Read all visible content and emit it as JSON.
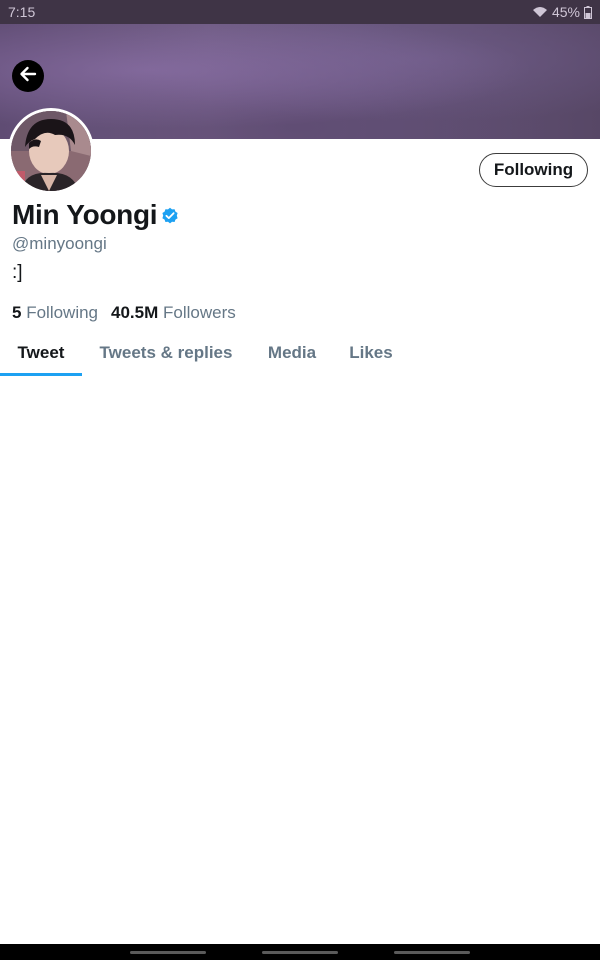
{
  "status_bar": {
    "time": "7:15",
    "battery": "45%",
    "icons": [
      "wifi-icon",
      "battery-icon"
    ]
  },
  "header": {
    "back_icon": "arrow-left-icon"
  },
  "profile": {
    "display_name": "Min Yoongi",
    "verified_icon": "verified-badge-icon",
    "handle": "@minyoongi",
    "bio": ":]",
    "follow_button_label": "Following",
    "following_count": "5",
    "following_label": "Following",
    "followers_count": "40.5M",
    "followers_label": "Followers"
  },
  "tabs": [
    {
      "label": "Tweet",
      "active": true
    },
    {
      "label": "Tweets & replies",
      "active": false
    },
    {
      "label": "Media",
      "active": false
    },
    {
      "label": "Likes",
      "active": false
    }
  ],
  "colors": {
    "accent": "#1da1f2",
    "secondary_text": "#657786",
    "primary_text": "#14171a"
  }
}
